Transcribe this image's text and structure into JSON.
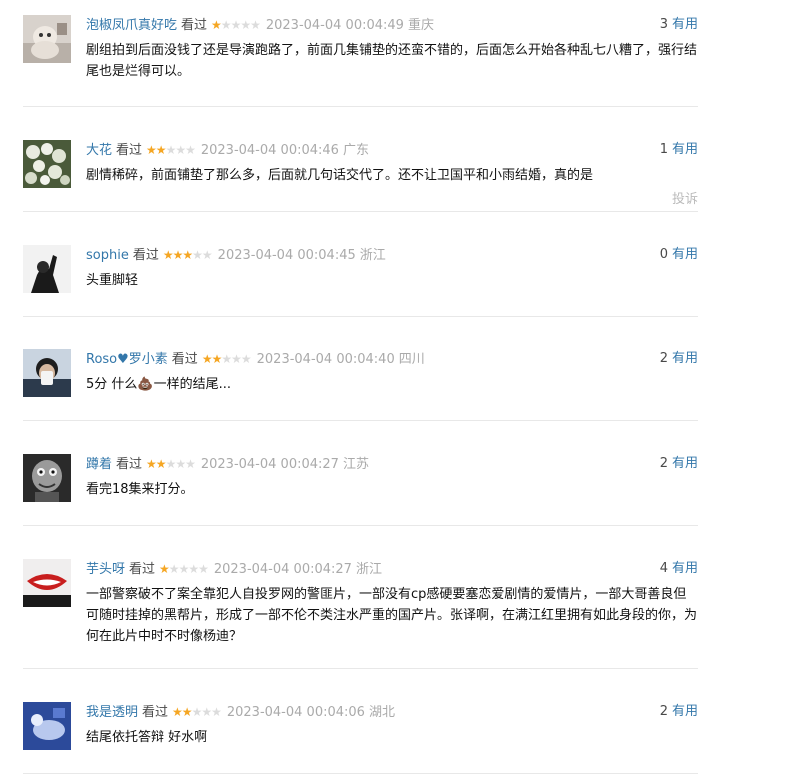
{
  "comments": [
    {
      "user": "泡椒凤爪真好吃",
      "watched": "看过",
      "rating": 1,
      "time": "2023-04-04 00:04:49",
      "location": "重庆",
      "votes": "3",
      "vote_label": "有用",
      "text": "剧组拍到后面没钱了还是导演跑路了，前面几集铺垫的还蛮不错的，后面怎么开始各种乱七八糟了，强行结尾也是烂得可以。"
    },
    {
      "user": "大花",
      "watched": "看过",
      "rating": 2,
      "time": "2023-04-04 00:04:46",
      "location": "广东",
      "votes": "1",
      "vote_label": "有用",
      "text": "剧情稀碎，前面铺垫了那么多，后面就几句话交代了。还不让卫国平和小雨结婚，真的是",
      "report": "投诉"
    },
    {
      "user": "sophie",
      "watched": "看过",
      "rating": 3,
      "time": "2023-04-04 00:04:45",
      "location": "浙江",
      "votes": "0",
      "vote_label": "有用",
      "text": "头重脚轻"
    },
    {
      "user": "Roso♥罗小素",
      "watched": "看过",
      "rating": 2,
      "time": "2023-04-04 00:04:40",
      "location": "四川",
      "votes": "2",
      "vote_label": "有用",
      "text_before": "5分 什么",
      "emoji": "💩",
      "text_after": "一样的结尾..."
    },
    {
      "user": "蹲着",
      "watched": "看过",
      "rating": 2,
      "time": "2023-04-04 00:04:27",
      "location": "江苏",
      "votes": "2",
      "vote_label": "有用",
      "text": "看完18集来打分。"
    },
    {
      "user": "芋头呀",
      "watched": "看过",
      "rating": 1,
      "time": "2023-04-04 00:04:27",
      "location": "浙江",
      "votes": "4",
      "vote_label": "有用",
      "text": "一部警察破不了案全靠犯人自投罗网的警匪片，一部没有cp感硬要塞恋爱剧情的爱情片，一部大哥善良但可随时挂掉的黑帮片，形成了一部不伦不类注水严重的国产片。张译啊，在满江红里拥有如此身段的你，为何在此片中时不时像杨迪？"
    },
    {
      "user": "我是透明",
      "watched": "看过",
      "rating": 2,
      "time": "2023-04-04 00:04:06",
      "location": "湖北",
      "votes": "2",
      "vote_label": "有用",
      "text": "结尾依托答辩 好水啊"
    }
  ],
  "colors": {
    "link": "#3377aa",
    "star": "#f5a623",
    "meta": "#aaaaaa"
  },
  "icons": [
    "avatar-photo",
    "star-icon"
  ]
}
